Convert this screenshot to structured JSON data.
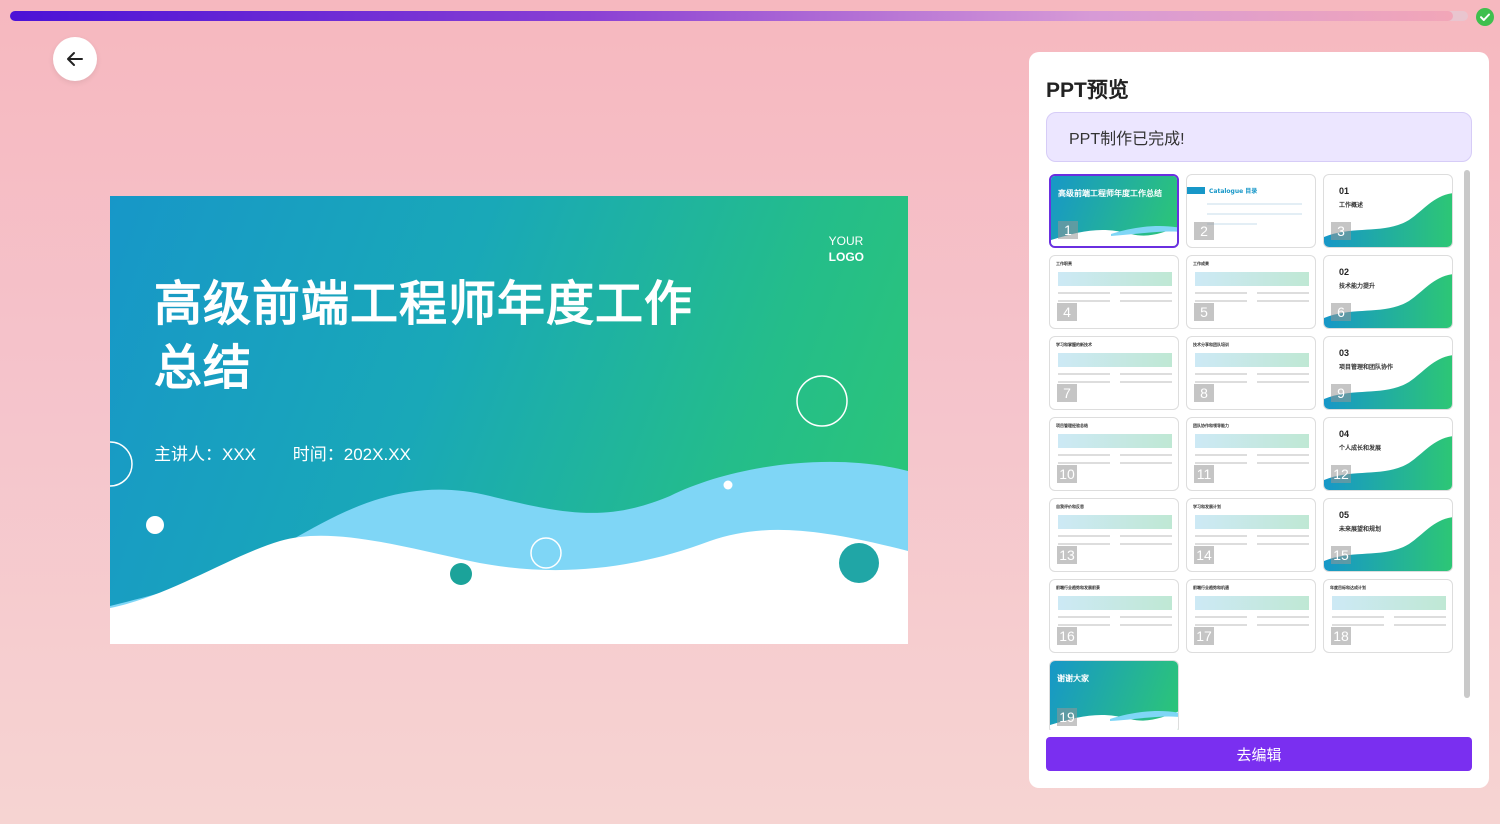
{
  "progress": {
    "fraction": 0.99,
    "complete": true
  },
  "back_button": {
    "icon": "arrow-left-icon"
  },
  "slide": {
    "logo_line1": "YOUR",
    "logo_line2": "LOGO",
    "title_line1": "高级前端工程师年度工作",
    "title_line2": "总结",
    "speaker": "主讲人：XXX",
    "time": "时间：202X.XX"
  },
  "panel": {
    "title": "PPT预览",
    "status": "PPT制作已完成!",
    "edit_label": "去编辑",
    "thumbnails": [
      {
        "num": "1",
        "type": "cover",
        "title": "高级前端工程师年度工作总结"
      },
      {
        "num": "2",
        "type": "catalog",
        "title": "Catalogue 目录"
      },
      {
        "num": "3",
        "type": "section",
        "sec": "01",
        "sub": "工作概述"
      },
      {
        "num": "4",
        "type": "content",
        "title": "工作职责"
      },
      {
        "num": "5",
        "type": "content",
        "title": "工作成果"
      },
      {
        "num": "6",
        "type": "section",
        "sec": "02",
        "sub": "技术能力提升"
      },
      {
        "num": "7",
        "type": "content",
        "title": "学习和掌握的新技术"
      },
      {
        "num": "8",
        "type": "content",
        "title": "技术分享和团队培训"
      },
      {
        "num": "9",
        "type": "section",
        "sec": "03",
        "sub": "项目管理和团队协作"
      },
      {
        "num": "10",
        "type": "content",
        "title": "项目管理经验总结"
      },
      {
        "num": "11",
        "type": "content",
        "title": "团队协作和领导能力"
      },
      {
        "num": "12",
        "type": "section",
        "sec": "04",
        "sub": "个人成长和发展"
      },
      {
        "num": "13",
        "type": "content",
        "title": "自我评价和反思"
      },
      {
        "num": "14",
        "type": "content",
        "title": "学习和发展计划"
      },
      {
        "num": "15",
        "type": "section",
        "sec": "05",
        "sub": "未来展望和规划"
      },
      {
        "num": "16",
        "type": "content",
        "title": "前端行业趋势和发展前景"
      },
      {
        "num": "17",
        "type": "content",
        "title": "前端行业趋势和机遇"
      },
      {
        "num": "18",
        "type": "content",
        "title": "年度目标和达成计划"
      },
      {
        "num": "19",
        "type": "cover",
        "title": "谢谢大家"
      }
    ]
  },
  "colors": {
    "accent": "#7a2ff0",
    "slide_start": "#1797c8",
    "slide_end": "#2dc774"
  }
}
